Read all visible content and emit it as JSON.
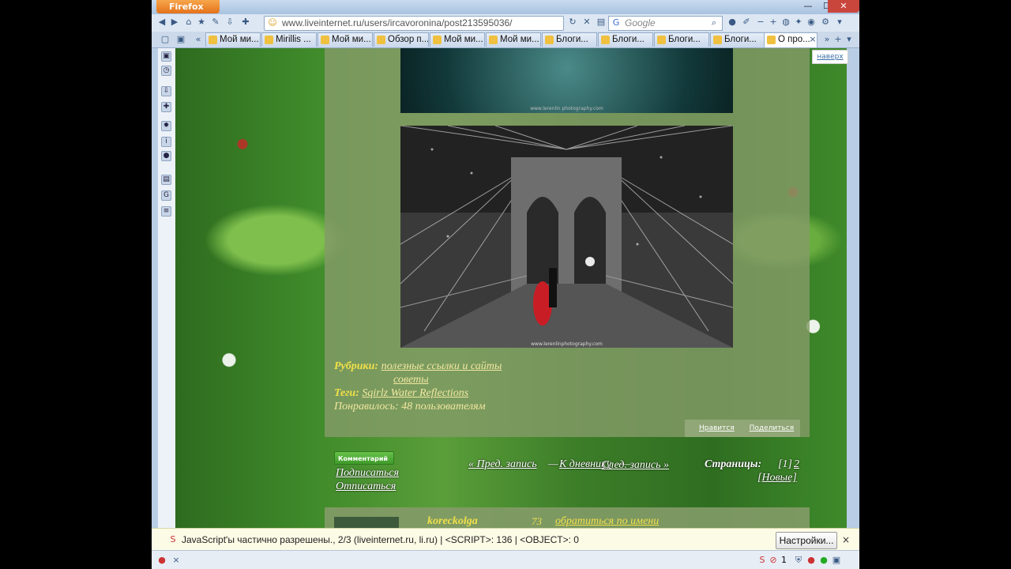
{
  "browser": {
    "button_label": "Firefox",
    "url": "www.liveinternet.ru/users/ircavoronina/post213595036/",
    "search_placeholder": "Google",
    "tabs": [
      {
        "label": "Мой ми..."
      },
      {
        "label": "Mirillis ..."
      },
      {
        "label": "Мой ми..."
      },
      {
        "label": "Обзор п..."
      },
      {
        "label": "Мой ми..."
      },
      {
        "label": "Мой ми..."
      },
      {
        "label": "Блоги..."
      },
      {
        "label": "Блоги..."
      },
      {
        "label": "Блоги..."
      },
      {
        "label": "Блоги..."
      },
      {
        "label": "О про..."
      }
    ]
  },
  "post": {
    "watermark_top": "www.lerenlin photography.com",
    "watermark_bridge": "www.lerenlinphotography.com",
    "rubrics_label": "Рубрики:",
    "rubric_1": "полезные ссылки и сайты",
    "rubric_2": "советы",
    "tags_label": "Теги:",
    "tag_1": "Sqirlz Water Reflections",
    "likes": "Понравилось: 48 пользователям",
    "like_action": "Нравится",
    "share_action": "Поделиться"
  },
  "navigation": {
    "up_link": "наверх",
    "comment_button": "Комментарий",
    "subscribe": "Подписаться",
    "unsubscribe": "Отписаться",
    "prev": "« Пред. запись",
    "sep1": "—",
    "to_diary": "К дневнику",
    "sep2": "—",
    "next": "След. запись »",
    "pages_label": "Страницы:",
    "page_current": "[1]",
    "page_2": "2",
    "new": "[Новые]"
  },
  "comment": {
    "user": "koreckolga",
    "rating": "73",
    "link": "обратиться по имени"
  },
  "notify": {
    "text": "JavaScript'ы частично разрешены., 2/3 (liveinternet.ru, li.ru) | <SCRIPT>: 136 | <OBJECT>: 0",
    "settings": "Настройки...",
    "close": "×"
  },
  "status": {
    "count": "1"
  }
}
